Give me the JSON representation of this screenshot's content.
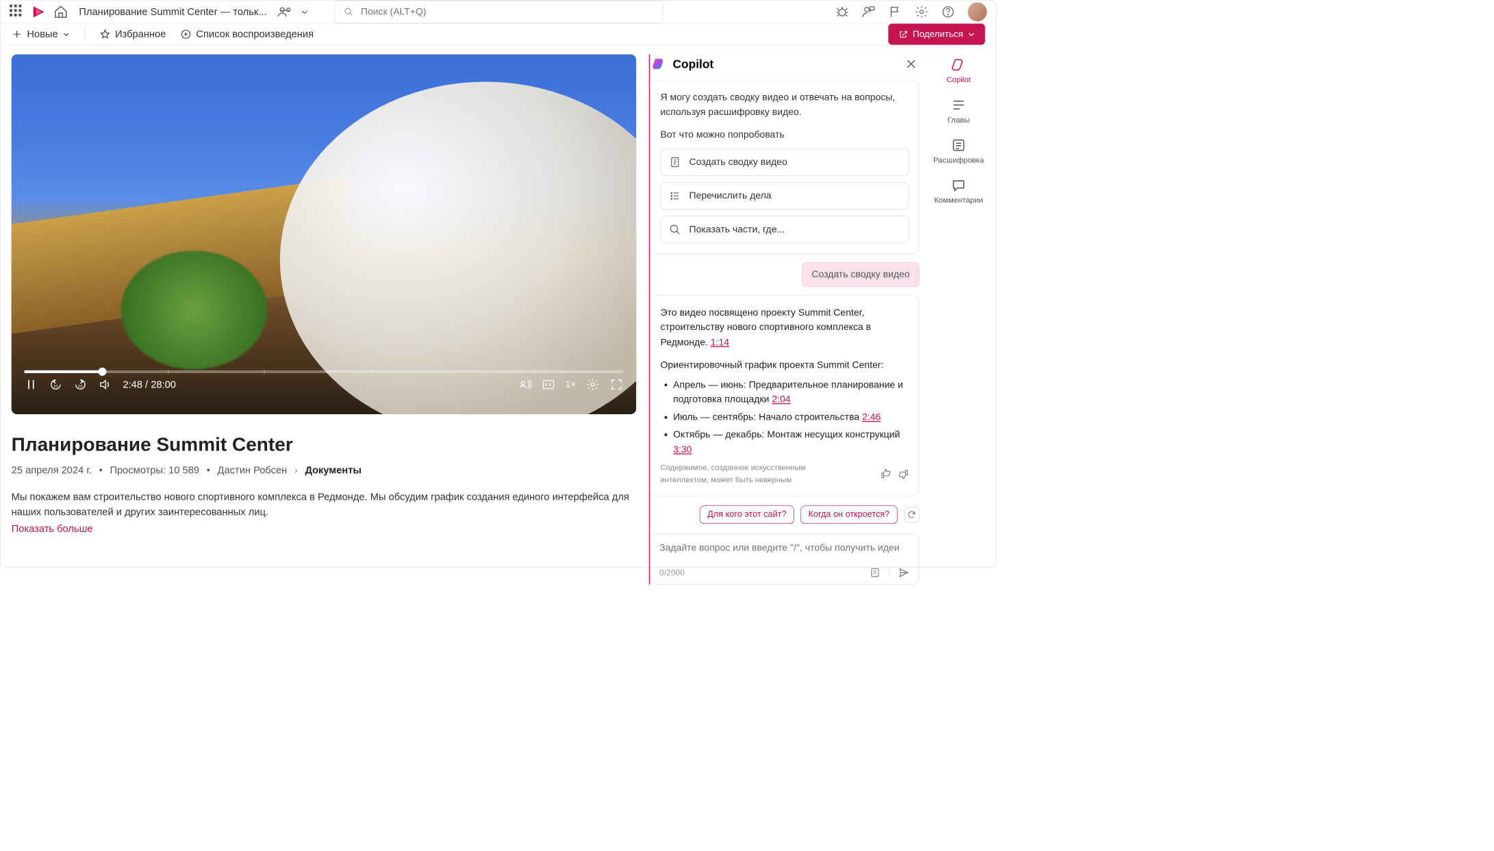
{
  "header": {
    "docTitle": "Планирование Summit Center — тольк...",
    "searchPlaceholder": "Поиск (ALT+Q)"
  },
  "toolbar": {
    "new": "Новые",
    "favorites": "Избранное",
    "playlist": "Список воспроизведения",
    "share": "Поделиться"
  },
  "video": {
    "timeCurrent": "2:48",
    "timeTotal": "28:00",
    "timeDisplay": "2:48 / 28:00",
    "speed": "1×",
    "title": "Планирование Summit Center",
    "date": "25 апреля 2024 г.",
    "views": "Просмотры: 10 589",
    "author": "Дастин Робсен",
    "breadcrumb": "Документы",
    "description": "Мы покажем вам строительство нового спортивного комплекса в Редмонде. Мы обсудим график создания единого интерфейса для наших пользователей и других заинтересованных лиц.",
    "showMore": "Показать больше"
  },
  "copilot": {
    "title": "Copilot",
    "intro": "Я могу создать сводку видео и отвечать на вопросы, используя расшифровку видео.",
    "tryLabel": "Вот что можно попробовать",
    "suggestions": {
      "summarize": "Создать сводку видео",
      "listTasks": "Перечислить дела",
      "showParts": "Показать части, где..."
    },
    "userMsg": "Создать сводку видео",
    "response": {
      "p1a": "Это видео посвящено проекту Summit Center, строительству нового спортивного комплекса в Редмонде. ",
      "t1": "1:14",
      "p2": "Ориентировочный график проекта Summit Center:",
      "b1a": "Апрель — июнь: Предварительное планирование и подготовка площадки ",
      "b1t": "2:04",
      "b2a": "Июль — сентябрь: Начало строительства ",
      "b2t": "2:46",
      "b3a": "Октябрь — декабрь: Монтаж несущих конструкций ",
      "b3t": "3:30"
    },
    "disclaimer": "Содержимое, созданное искусственным интеллектом, может быть неверным",
    "followups": {
      "q1": "Для кого этот сайт?",
      "q2": "Когда он откроется?"
    },
    "inputPlaceholder": "Задайте вопрос или введите \"/\", чтобы получить идеи",
    "charCount": "0/2000"
  },
  "sideTabs": {
    "copilot": "Copilot",
    "chapters": "Главы",
    "transcript": "Расшифровка",
    "comments": "Комментарии"
  }
}
